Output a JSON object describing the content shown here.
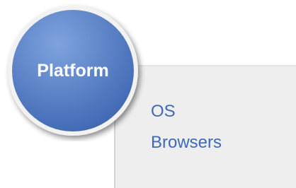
{
  "circle": {
    "label": "Platform"
  },
  "panel": {
    "items": [
      "OS",
      "Browsers"
    ]
  },
  "colors": {
    "circle_fill": "#3f67b2",
    "circle_highlight": "#7ea3de",
    "circle_ring": "#f2f2f2",
    "circle_text": "#ffffff",
    "panel_background": "#eeeeee",
    "panel_text": "#3e6ab8"
  }
}
